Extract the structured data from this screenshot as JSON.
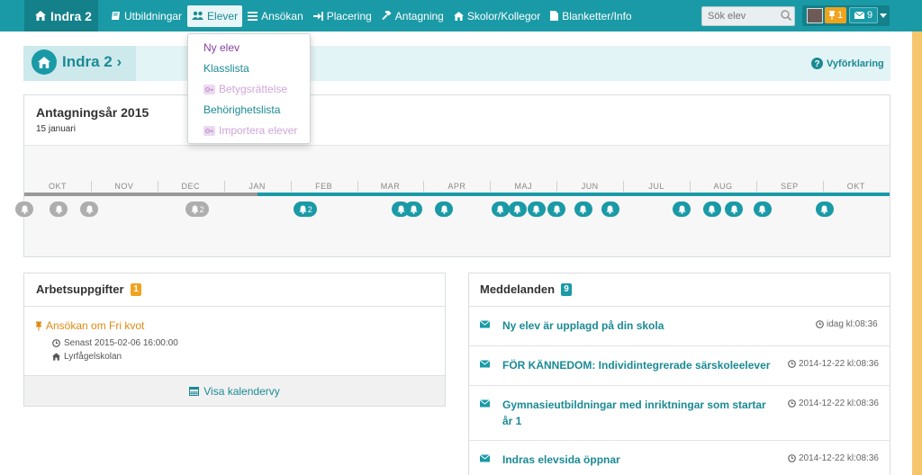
{
  "brand": {
    "label": "Indra 2",
    "icon": "home-icon"
  },
  "nav": {
    "items": [
      {
        "label": "Utbildningar",
        "icon": "book-icon"
      },
      {
        "label": "Elever",
        "icon": "users-icon",
        "active": true
      },
      {
        "label": "Ansökan",
        "icon": "list-icon"
      },
      {
        "label": "Placering",
        "icon": "sign-in-icon"
      },
      {
        "label": "Antagning",
        "icon": "gavel-icon"
      },
      {
        "label": "Skolor/Kollegor",
        "icon": "home-icon"
      },
      {
        "label": "Blanketter/Info",
        "icon": "file-icon"
      }
    ]
  },
  "search": {
    "placeholder": "Sök elev"
  },
  "user": {
    "tasks_count": "1",
    "messages_count": "9"
  },
  "dropdown": {
    "items": [
      {
        "label": "Ny elev",
        "state": "visited"
      },
      {
        "label": "Klasslista",
        "state": "normal"
      },
      {
        "label": "Betygsrättelse",
        "state": "disabled",
        "icon": "key-icon"
      },
      {
        "label": "Behörighetslista",
        "state": "normal"
      },
      {
        "label": "Importera elever",
        "state": "disabled",
        "icon": "key-icon"
      }
    ]
  },
  "breadcrumb": {
    "label": "Indra 2 ›"
  },
  "help": {
    "label": "Vyförklaring"
  },
  "timeline": {
    "title": "Antagningsår 2015",
    "date": "15 januari",
    "months": [
      "OKT",
      "NOV",
      "DEC",
      "JAN",
      "FEB",
      "MAR",
      "APR",
      "MAJ",
      "JUN",
      "JUL",
      "AUG",
      "SEP",
      "OKT"
    ],
    "events": [
      {
        "pos": 0.0,
        "count": "",
        "past": true
      },
      {
        "pos": 0.04,
        "count": "",
        "past": true
      },
      {
        "pos": 0.075,
        "count": "",
        "past": true
      },
      {
        "pos": 0.2,
        "count": "2",
        "past": true
      },
      {
        "pos": 0.325,
        "count": "2",
        "past": false
      },
      {
        "pos": 0.435,
        "count": "",
        "past": false
      },
      {
        "pos": 0.45,
        "count": "",
        "past": false
      },
      {
        "pos": 0.485,
        "count": "",
        "past": false
      },
      {
        "pos": 0.55,
        "count": "",
        "past": false
      },
      {
        "pos": 0.57,
        "count": "",
        "past": false
      },
      {
        "pos": 0.592,
        "count": "",
        "past": false
      },
      {
        "pos": 0.615,
        "count": "",
        "past": false
      },
      {
        "pos": 0.646,
        "count": "",
        "past": false
      },
      {
        "pos": 0.677,
        "count": "",
        "past": false
      },
      {
        "pos": 0.76,
        "count": "",
        "past": false
      },
      {
        "pos": 0.795,
        "count": "",
        "past": false
      },
      {
        "pos": 0.82,
        "count": "",
        "past": false
      },
      {
        "pos": 0.853,
        "count": "",
        "past": false
      },
      {
        "pos": 0.925,
        "count": "",
        "past": false
      }
    ]
  },
  "tasks": {
    "title": "Arbetsuppgifter",
    "count": "1",
    "item": {
      "label": "Ansökan om Fri kvot",
      "deadline": "Senast 2015-02-06 16:00:00",
      "school": "Lyrfågelskolan"
    },
    "footer": "Visa kalendervy"
  },
  "messages": {
    "title": "Meddelanden",
    "count": "9",
    "items": [
      {
        "text": "Ny elev är upplagd på din skola",
        "time": "idag kl:08:36"
      },
      {
        "text": "FÖR KÄNNEDOM: Individintegrerade särskoleelever",
        "time": "2014-12-22 kl:08:36"
      },
      {
        "text": "Gymnasieutbildningar med inriktningar som startar år 1",
        "time": "2014-12-22 kl:08:36"
      },
      {
        "text": "Indras elevsida öppnar",
        "time": "2014-12-22 kl:08:36"
      }
    ]
  },
  "colors": {
    "accent": "#1a9aa6",
    "accent_dark": "#13808a",
    "task_orange": "#f0a31e",
    "visited_purple": "#8a3fa0"
  }
}
